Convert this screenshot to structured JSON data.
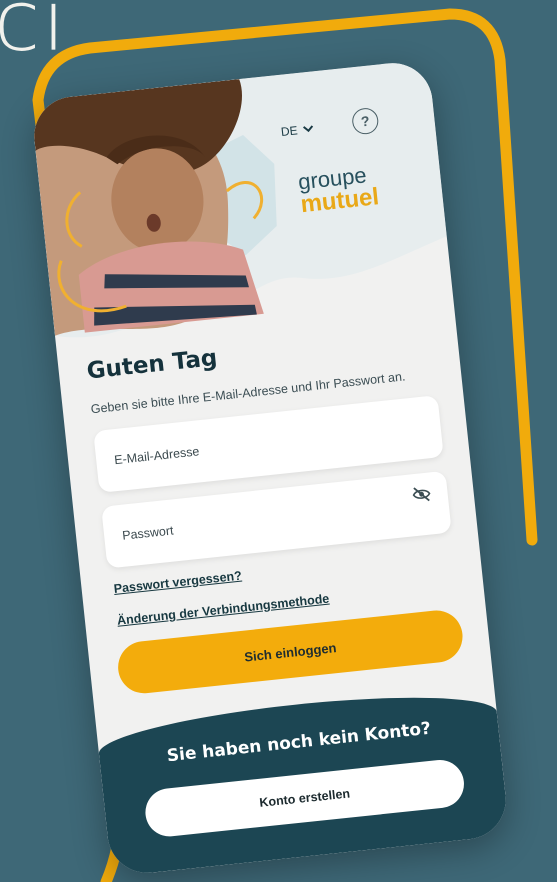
{
  "background": {
    "headline_partial": "ci"
  },
  "header": {
    "language": "DE",
    "language_icon": "chevron-down-icon",
    "help_icon": "question-circle-icon",
    "help_glyph": "?",
    "logo_line1": "groupe",
    "logo_line2": "mutuel"
  },
  "login": {
    "greeting": "Guten Tag",
    "subtitle": "Geben sie bitte Ihre E-Mail-Adresse und Ihr Passwort an.",
    "email_placeholder": "E-Mail-Adresse",
    "password_placeholder": "Passwort",
    "password_toggle_icon": "eye-off-icon",
    "forgot_password": "Passwort vergessen?",
    "change_method": "Änderung der Verbindungsmethode",
    "submit": "Sich einloggen"
  },
  "footer": {
    "no_account": "Sie haben noch kein Konto?",
    "create_account": "Konto erstellen"
  },
  "colors": {
    "background": "#3e6877",
    "accent_yellow": "#f3ac0c",
    "footer_teal": "#1c4653",
    "logo_teal": "#27505d",
    "logo_yellow": "#e9a817"
  }
}
